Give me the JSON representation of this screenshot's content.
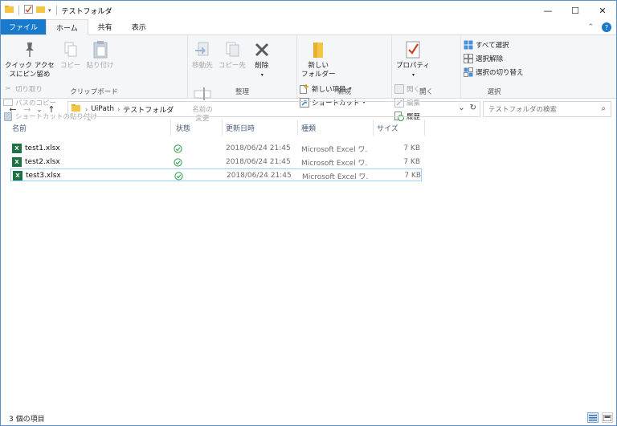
{
  "window": {
    "title": "テストフォルダ",
    "controls": {
      "minimize": "—",
      "maximize": "☐",
      "close": "✕"
    }
  },
  "ribbon_tabs": [
    {
      "label": "ファイル"
    },
    {
      "label": "ホーム"
    },
    {
      "label": "共有"
    },
    {
      "label": "表示"
    }
  ],
  "ribbon": {
    "clipboard": {
      "label": "クリップボード",
      "pin_line1": "クイック アクセ",
      "pin_line2": "スにピン留め",
      "copy": "コピー",
      "paste": "貼り付け",
      "cut": "切り取り",
      "copy_path": "パスのコピー",
      "paste_shortcut": "ショートカットの貼り付け"
    },
    "organize": {
      "label": "整理",
      "move_to": "移動先",
      "copy_to": "コピー先",
      "delete": "削除",
      "rename_line1": "名前の",
      "rename_line2": "変更"
    },
    "new": {
      "label": "新規",
      "new_folder_line1": "新しい",
      "new_folder_line2": "フォルダー",
      "new_item": "新しい項目",
      "shortcut": "ショートカット"
    },
    "open": {
      "label": "開く",
      "properties": "プロパティ",
      "open": "開く",
      "edit": "編集",
      "history": "履歴"
    },
    "select": {
      "label": "選択",
      "select_all": "すべて選択",
      "select_none": "選択解除",
      "invert": "選択の切り替え"
    }
  },
  "address": {
    "crumbs": [
      "UiPath",
      "テストフォルダ"
    ],
    "search_placeholder": "テストフォルダの検索"
  },
  "columns": {
    "name": "名前",
    "status": "状態",
    "date": "更新日時",
    "type": "種類",
    "size": "サイズ"
  },
  "files": [
    {
      "name": "test1.xlsx",
      "date": "2018/06/24 21:45",
      "type": "Microsoft Excel ワ...",
      "size": "7 KB"
    },
    {
      "name": "test2.xlsx",
      "date": "2018/06/24 21:45",
      "type": "Microsoft Excel ワ...",
      "size": "7 KB"
    },
    {
      "name": "test3.xlsx",
      "date": "2018/06/24 21:45",
      "type": "Microsoft Excel ワ...",
      "size": "7 KB"
    }
  ],
  "status_bar": {
    "count": "3 個の項目"
  },
  "colors": {
    "file_tab": "#1979ca",
    "status_ok": "#2e9b4a",
    "excel": "#1e7145"
  }
}
